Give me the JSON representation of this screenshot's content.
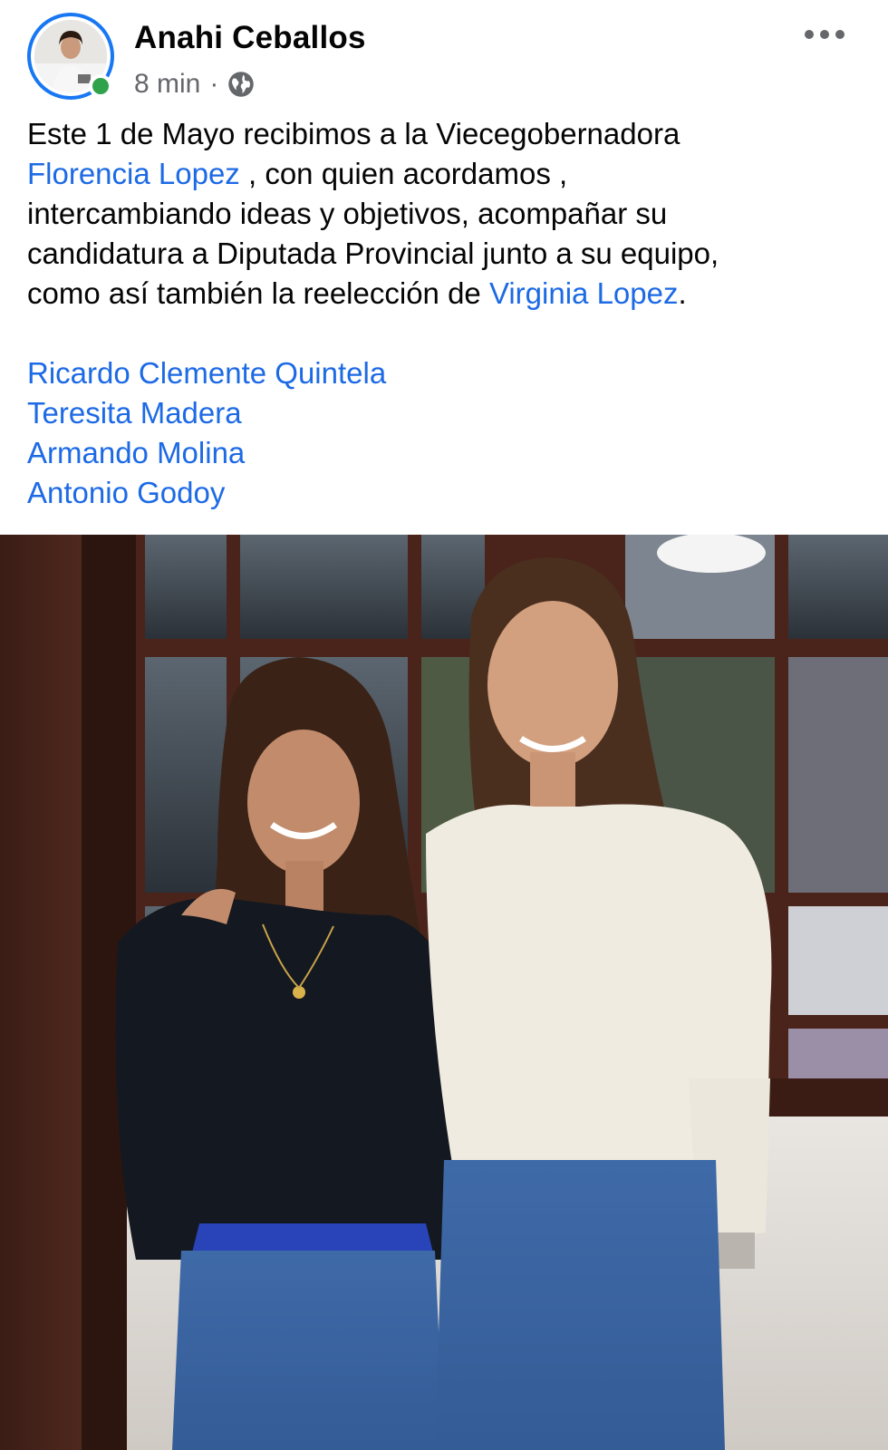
{
  "post": {
    "author": {
      "name": "Anahi Ceballos",
      "online": true,
      "avatar": "profile-photo"
    },
    "timestamp": "8 min",
    "separator": "·",
    "audience_icon": "globe-icon",
    "more_icon": "ellipsis-icon",
    "text": {
      "line1": "Este 1 de Mayo recibimos a la Viecegobernadora",
      "mention1": "Florencia Lopez",
      "after_mention1": " , con quien acordamos ,",
      "line3": "intercambiando ideas y objetivos, acompañar su",
      "line4": "candidatura a Diputada Provincial junto a su equipo,",
      "line5_pre": "como así también la reelección de ",
      "mention2": "Virginia Lopez",
      "line5_post": "."
    },
    "tags": [
      "Ricardo Clemente Quintela",
      "Teresita Madera",
      "Armando Molina",
      "Antonio Godoy"
    ],
    "photo": {
      "description_icon": "post-photo"
    }
  },
  "colors": {
    "link": "#1d6ae5",
    "online": "#31a24c",
    "ring": "#1877f2",
    "meta": "#65676b"
  }
}
